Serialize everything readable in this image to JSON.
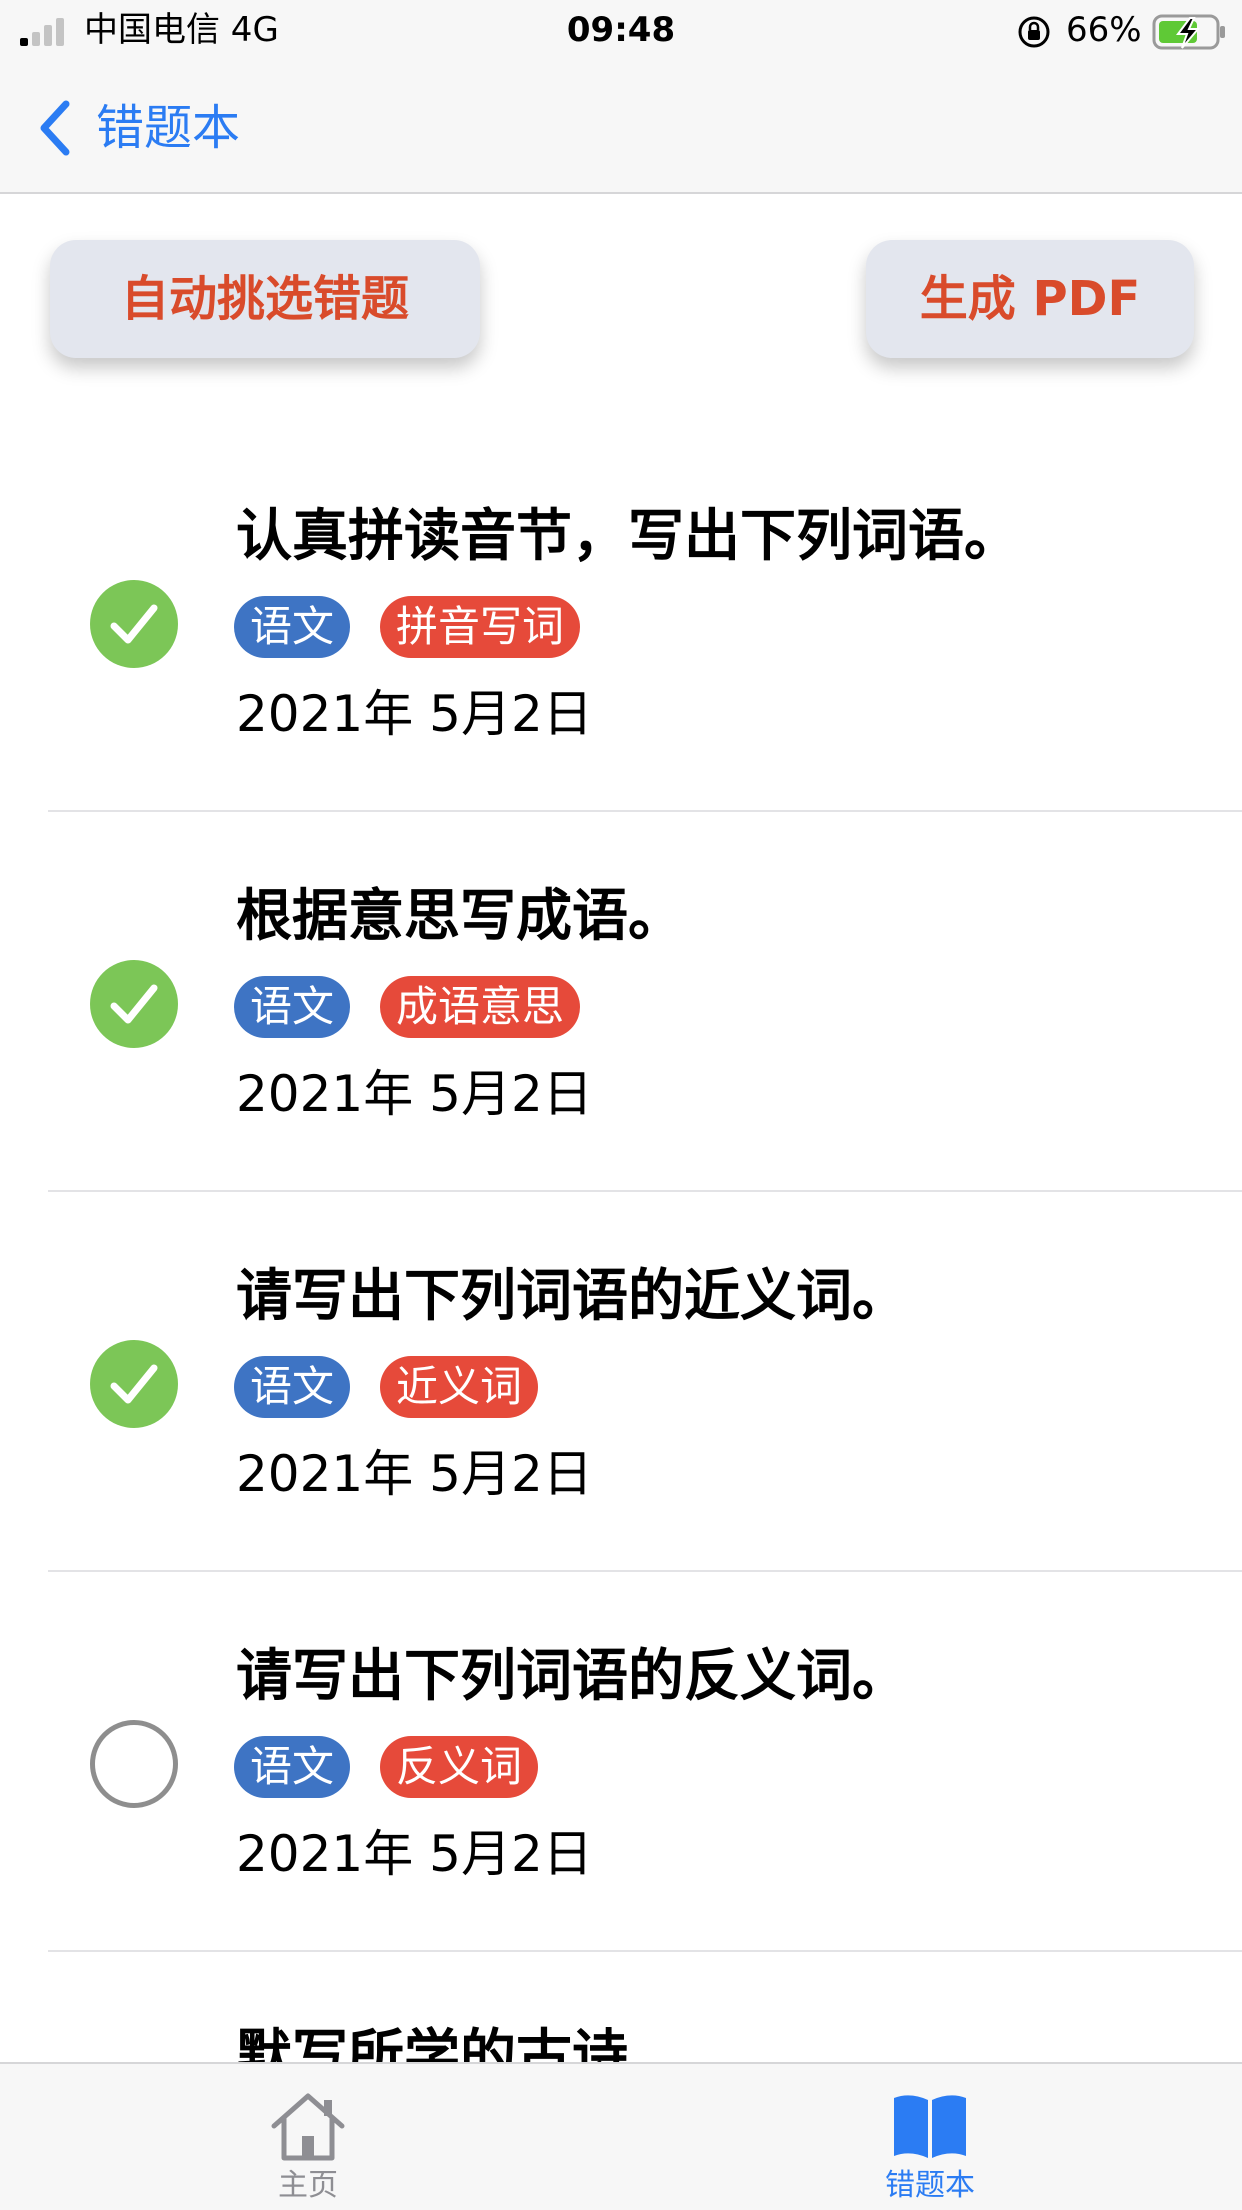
{
  "status_bar": {
    "carrier": "中国电信   4G",
    "time": "09:48",
    "battery": "66%"
  },
  "nav": {
    "title": "错题本"
  },
  "actions": {
    "auto_select": "自动挑选错题",
    "generate_pdf": "生成 PDF"
  },
  "items": [
    {
      "title": "认真拼读音节，写出下列词语。",
      "subject": "语文",
      "topic": "拼音写词",
      "date": "2021年 5月2日",
      "checked": true
    },
    {
      "title": "根据意思写成语。",
      "subject": "语文",
      "topic": "成语意思",
      "date": "2021年 5月2日",
      "checked": true
    },
    {
      "title": "请写出下列词语的近义词。",
      "subject": "语文",
      "topic": "近义词",
      "date": "2021年 5月2日",
      "checked": true
    },
    {
      "title": "请写出下列词语的反义词。",
      "subject": "语文",
      "topic": "反义词",
      "date": "2021年 5月2日",
      "checked": false
    },
    {
      "title": "默写所学的古诗"
    }
  ],
  "tab_bar": {
    "home": "主页",
    "notebook": "错题本"
  },
  "colors": {
    "accent": "#2b7cf3",
    "action_text": "#d94b2b",
    "check_done": "#7cc657",
    "tag_subject": "#3e74c4",
    "tag_topic": "#e64a3a"
  },
  "icons": {
    "back": "chevron-left-icon",
    "check": "checkmark-icon",
    "home": "house-icon",
    "notebook": "open-book-icon"
  }
}
